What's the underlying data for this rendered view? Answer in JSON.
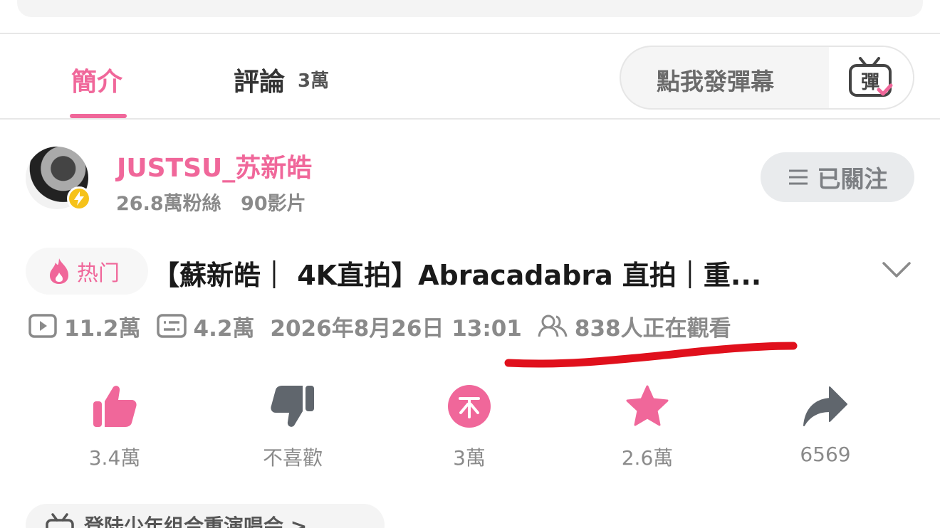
{
  "tabs": {
    "intro_label": "簡介",
    "comments_label": "評論",
    "comments_count": "3萬"
  },
  "danmaku": {
    "placeholder": "點我發彈幕",
    "button_icon": "danmaku-tv-icon"
  },
  "uploader": {
    "name": "JUSTSU_苏新皓",
    "followers": "26.8萬粉絲",
    "videos": "90影片",
    "follow_label": "已關注"
  },
  "video": {
    "hot_label": "热门",
    "title": "【蘇新皓｜ 4K直拍】Abracadabra 直拍｜重...",
    "plays": "11.2萬",
    "danmaku_count": "4.2萬",
    "datetime": "2026年8月26日 13:01",
    "watching": "838人正在觀看"
  },
  "actions": {
    "like": "3.4萬",
    "dislike": "不喜歡",
    "coin": "3萬",
    "favorite": "2.6萬",
    "share": "6569"
  },
  "bottom": {
    "label": "登陆少年组合重演唱会 >"
  },
  "colors": {
    "accent": "#f0679a",
    "annotation": "#e0101c",
    "muted": "#8a8a8a"
  }
}
